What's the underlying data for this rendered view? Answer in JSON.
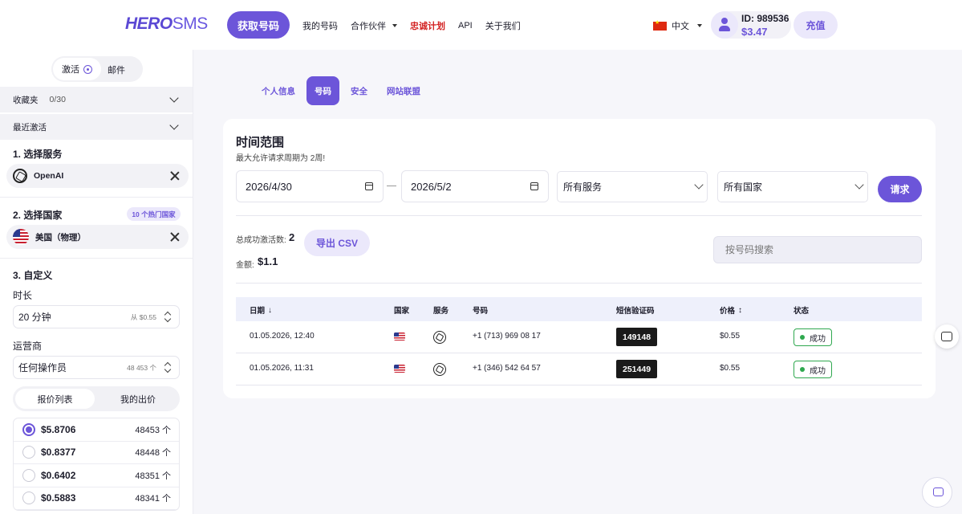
{
  "header": {
    "logo_main": "HERO",
    "logo_sms": "SMS",
    "get_number": "获取号码",
    "nav": [
      "我的号码",
      "合作伙伴",
      "忠诚计划",
      "API",
      "关于我们"
    ],
    "lang": "中文",
    "user_id": "ID: 989536",
    "balance": "$3.47",
    "topup": "充值"
  },
  "sidebar": {
    "mode_activation": "激活",
    "mode_mail": "邮件",
    "favorites": "收藏夹",
    "favorites_count": "0/30",
    "recent": "最近激活",
    "step1": "1. 选择服务",
    "service": "OpenAI",
    "step2": "2. 选择国家",
    "hot_badge": "10 个热门国家",
    "country": "美国（物理）",
    "step3": "3. 自定义",
    "duration_label": "时长",
    "duration_value": "20 分钟",
    "duration_hint": "从 $0.55",
    "operator_label": "运营商",
    "operator_value": "任何操作员",
    "operator_hint": "48 453 个",
    "price_list_tab": "报价列表",
    "my_offer_tab": "我的出价",
    "prices": [
      {
        "price": "$5.8706",
        "qty": "48453 个",
        "selected": true
      },
      {
        "price": "$0.8377",
        "qty": "48448 个",
        "selected": false
      },
      {
        "price": "$0.6402",
        "qty": "48351 个",
        "selected": false
      },
      {
        "price": "$0.5883",
        "qty": "48341 个",
        "selected": false
      }
    ]
  },
  "tabs": [
    "个人信息",
    "号码",
    "安全",
    "网站联盟"
  ],
  "main": {
    "title": "时间范围",
    "subtitle": "最大允许请求周期为 2周!",
    "date_from": "2026/4/30",
    "date_to": "2026/5/2",
    "service_filter": "所有服务",
    "country_filter": "所有国家",
    "request_btn": "请求",
    "total_label": "总成功激活数:",
    "total_value": "2",
    "amount_label": "金额:",
    "amount_value": "$1.1",
    "export_btn": "导出 CSV",
    "search_placeholder": "按号码搜索",
    "columns": {
      "date": "日期",
      "country": "国家",
      "service": "服务",
      "number": "号码",
      "code": "短信验证码",
      "price": "价格",
      "status": "状态"
    },
    "rows": [
      {
        "date": "01.05.2026, 12:40",
        "number": "+1 (713) 969 08 17",
        "code": "149148",
        "price": "$0.55",
        "status": "成功"
      },
      {
        "date": "01.05.2026, 11:31",
        "number": "+1 (346) 542 64 57",
        "code": "251449",
        "price": "$0.55",
        "status": "成功"
      }
    ]
  }
}
